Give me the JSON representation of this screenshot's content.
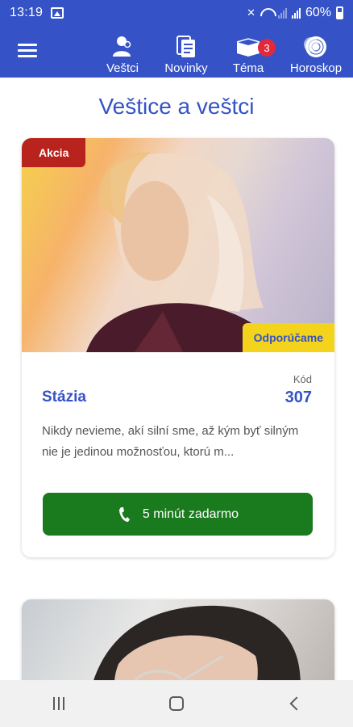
{
  "status_bar": {
    "time": "13:19",
    "battery": "60%"
  },
  "app_bar": {
    "menu_icon": "hamburger-icon",
    "nav": [
      {
        "label": "Veštci",
        "icon": "people-icon"
      },
      {
        "label": "Novinky",
        "icon": "news-icon"
      },
      {
        "label": "Téma",
        "icon": "book-icon",
        "badge": "3"
      },
      {
        "label": "Horoskop",
        "icon": "zodiac-icon"
      }
    ],
    "background": "#3553c6",
    "badge_color": "#e2283a"
  },
  "page": {
    "title": "Veštice a veštci"
  },
  "cards": [
    {
      "tag_sale": "Akcia",
      "tag_recommended": "Odporúčame",
      "kod_label": "Kód",
      "name": "Stázia",
      "kod": "307",
      "description": "Nikdy nevieme, akí silní sme, až kým byť silným nie je jedinou možnosťou, ktorú m...",
      "cta_label": "5 minút zadarmo",
      "cta_icon": "phone-icon"
    }
  ],
  "colors": {
    "accent": "#3553c6",
    "sale": "#b8231e",
    "recommended": "#f4d31c",
    "cta": "#1a7a1e"
  },
  "system_nav": [
    "recents-icon",
    "home-icon",
    "back-icon"
  ]
}
